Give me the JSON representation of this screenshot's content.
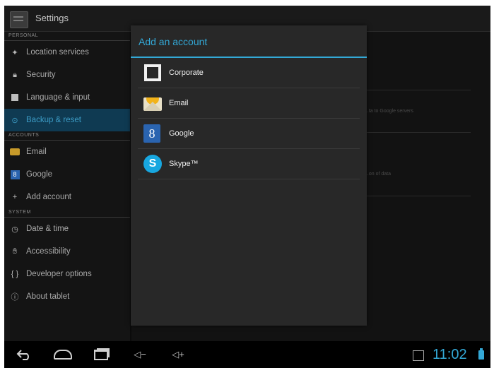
{
  "app": {
    "title": "Settings",
    "icon": "settings-icon"
  },
  "sidebar": {
    "sections": [
      {
        "header": "PERSONAL",
        "items": [
          {
            "label": "Location services",
            "icon": "location-icon"
          },
          {
            "label": "Security",
            "icon": "lock-icon"
          },
          {
            "label": "Language & input",
            "icon": "keyboard-icon"
          },
          {
            "label": "Backup & reset",
            "icon": "backup-icon",
            "selected": true
          }
        ]
      },
      {
        "header": "ACCOUNTS",
        "items": [
          {
            "label": "Email",
            "icon": "email-icon"
          },
          {
            "label": "Google",
            "icon": "google-icon"
          },
          {
            "label": "Add account",
            "icon": "plus-icon"
          }
        ]
      },
      {
        "header": "SYSTEM",
        "items": [
          {
            "label": "Date & time",
            "icon": "clock-icon"
          },
          {
            "label": "Accessibility",
            "icon": "hand-icon"
          },
          {
            "label": "Developer options",
            "icon": "braces-icon"
          },
          {
            "label": "About tablet",
            "icon": "info-icon"
          }
        ]
      }
    ]
  },
  "dialog": {
    "title": "Add an account",
    "accounts": [
      {
        "label": "Corporate",
        "icon": "corporate-icon"
      },
      {
        "label": "Email",
        "icon": "email-icon"
      },
      {
        "label": "Google",
        "icon": "google-icon",
        "glyph": "8"
      },
      {
        "label": "Skype™",
        "icon": "skype-icon",
        "glyph": "S"
      }
    ]
  },
  "background_pane": {
    "faded_text_1": "...ta to Google servers",
    "faded_text_2": "...on of data"
  },
  "navbar": {
    "back": "back-icon",
    "home": "home-icon",
    "recents": "recents-icon",
    "volume_down": "◁−",
    "volume_up": "◁+"
  },
  "status": {
    "time": "11:02"
  },
  "colors": {
    "accent": "#33a8d6",
    "selected_bg": "#0f3a52",
    "dialog_bg": "#282828"
  }
}
